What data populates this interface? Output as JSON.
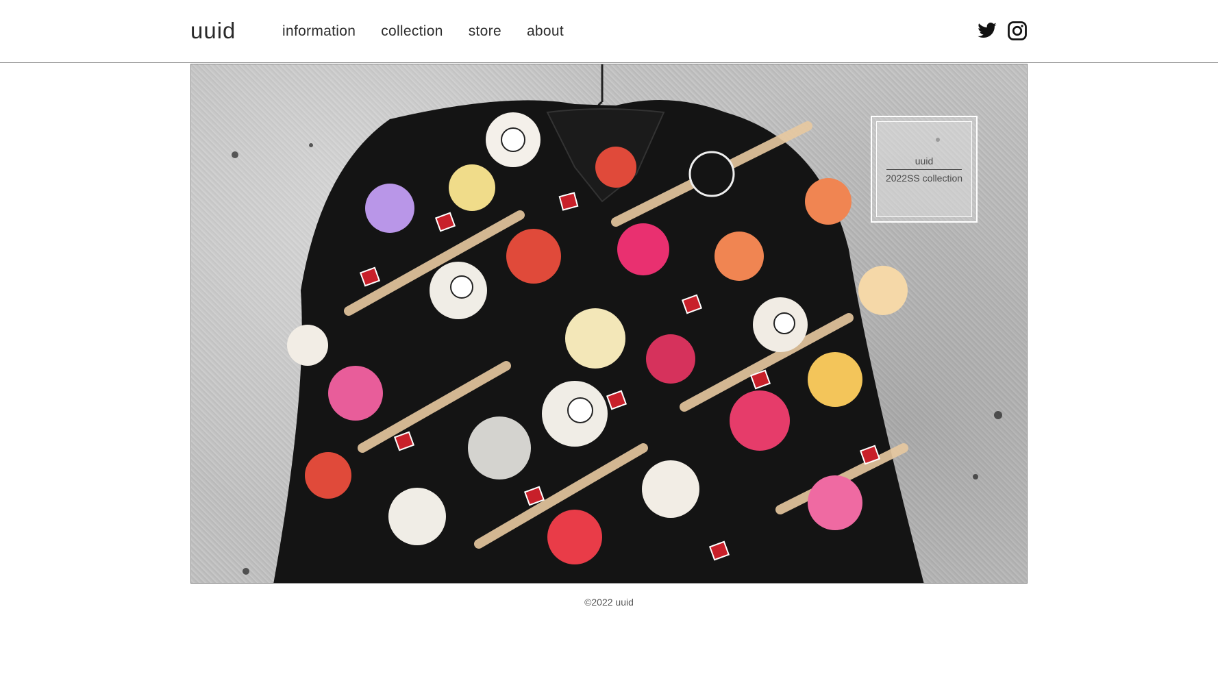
{
  "header": {
    "logo": "uuid",
    "nav": [
      {
        "label": "information"
      },
      {
        "label": "collection"
      },
      {
        "label": "store"
      },
      {
        "label": "about"
      }
    ],
    "social": [
      {
        "icon": "twitter-icon"
      },
      {
        "icon": "instagram-icon"
      }
    ]
  },
  "hero": {
    "label_brand": "uuid",
    "label_collection": "2022SS collection"
  },
  "footer": {
    "copyright": "©2022 uuid"
  },
  "colors": {
    "background": "#ffffff",
    "text": "#2c2c2c",
    "divider": "#8a8a8a",
    "shirt": "#141414"
  }
}
